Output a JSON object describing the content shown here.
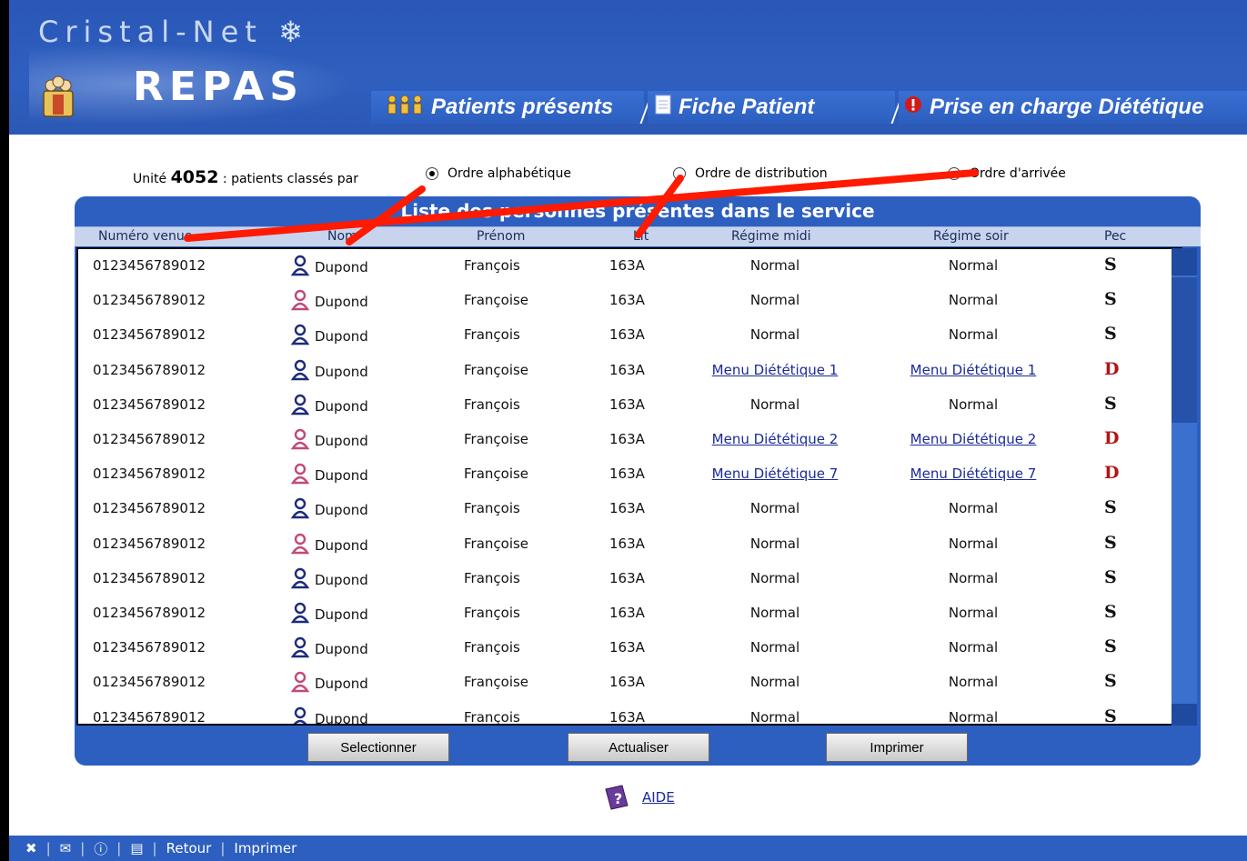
{
  "header": {
    "brand": "Cristal-Net",
    "app_title": "REPAS"
  },
  "tabs": [
    {
      "label": "Patients présents"
    },
    {
      "label": "Fiche Patient"
    },
    {
      "label": "Prise en charge Diététique"
    }
  ],
  "sort": {
    "unit_prefix": "Unité",
    "unit_number": "4052",
    "unit_suffix": ": patients classés par",
    "options": [
      {
        "label": "Ordre alphabétique",
        "selected": true
      },
      {
        "label": "Ordre de distribution",
        "selected": false
      },
      {
        "label": "Ordre d'arrivée",
        "selected": false
      }
    ]
  },
  "panel": {
    "title": "Liste des personnes présentes dans le service",
    "columns": [
      "Numéro venue",
      "Nom",
      "Prénom",
      "Lit",
      "Régime midi",
      "Régime soir",
      "Pec"
    ]
  },
  "rows": [
    {
      "num": "0123456789012",
      "gender": "m",
      "nom": "Dupond",
      "prenom": "François",
      "lit": "163A",
      "midi": "Normal",
      "soir": "Normal",
      "pec": "S"
    },
    {
      "num": "0123456789012",
      "gender": "f",
      "nom": "Dupond",
      "prenom": "Françoise",
      "lit": "163A",
      "midi": "Normal",
      "soir": "Normal",
      "pec": "S"
    },
    {
      "num": "0123456789012",
      "gender": "m",
      "nom": "Dupond",
      "prenom": "François",
      "lit": "163A",
      "midi": "Normal",
      "soir": "Normal",
      "pec": "S"
    },
    {
      "num": "0123456789012",
      "gender": "m",
      "nom": "Dupond",
      "prenom": "Françoise",
      "lit": "163A",
      "midi": "Menu Diététique 1",
      "soir": "Menu Diététique 1",
      "pec": "D"
    },
    {
      "num": "0123456789012",
      "gender": "m",
      "nom": "Dupond",
      "prenom": "François",
      "lit": "163A",
      "midi": "Normal",
      "soir": "Normal",
      "pec": "S"
    },
    {
      "num": "0123456789012",
      "gender": "f",
      "nom": "Dupond",
      "prenom": "Françoise",
      "lit": "163A",
      "midi": "Menu Diététique 2",
      "soir": "Menu Diététique 2",
      "pec": "D"
    },
    {
      "num": "0123456789012",
      "gender": "f",
      "nom": "Dupond",
      "prenom": "Françoise",
      "lit": "163A",
      "midi": "Menu Diététique 7",
      "soir": "Menu Diététique 7",
      "pec": "D"
    },
    {
      "num": "0123456789012",
      "gender": "m",
      "nom": "Dupond",
      "prenom": "François",
      "lit": "163A",
      "midi": "Normal",
      "soir": "Normal",
      "pec": "S"
    },
    {
      "num": "0123456789012",
      "gender": "f",
      "nom": "Dupond",
      "prenom": "Françoise",
      "lit": "163A",
      "midi": "Normal",
      "soir": "Normal",
      "pec": "S"
    },
    {
      "num": "0123456789012",
      "gender": "m",
      "nom": "Dupond",
      "prenom": "François",
      "lit": "163A",
      "midi": "Normal",
      "soir": "Normal",
      "pec": "S"
    },
    {
      "num": "0123456789012",
      "gender": "m",
      "nom": "Dupond",
      "prenom": "François",
      "lit": "163A",
      "midi": "Normal",
      "soir": "Normal",
      "pec": "S"
    },
    {
      "num": "0123456789012",
      "gender": "m",
      "nom": "Dupond",
      "prenom": "François",
      "lit": "163A",
      "midi": "Normal",
      "soir": "Normal",
      "pec": "S"
    },
    {
      "num": "0123456789012",
      "gender": "f",
      "nom": "Dupond",
      "prenom": "Françoise",
      "lit": "163A",
      "midi": "Normal",
      "soir": "Normal",
      "pec": "S"
    },
    {
      "num": "0123456789012",
      "gender": "m",
      "nom": "Dupond",
      "prenom": "François",
      "lit": "163A",
      "midi": "Normal",
      "soir": "Normal",
      "pec": "S"
    }
  ],
  "buttons": {
    "select": "Selectionner",
    "refresh": "Actualiser",
    "print": "Imprimer"
  },
  "aide": "AIDE",
  "footer": {
    "retour": "Retour",
    "imprimer": "Imprimer"
  },
  "colors": {
    "brand_blue": "#2d5fc0",
    "annotation_red": "#ff1a00",
    "pec_d": "#b01515"
  }
}
